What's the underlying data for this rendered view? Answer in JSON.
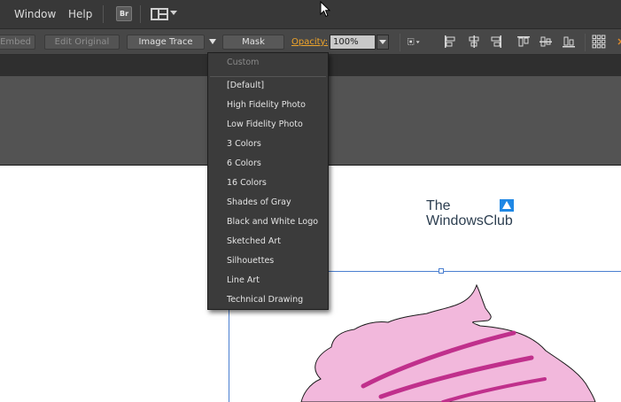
{
  "menubar": {
    "items": [
      "Window",
      "Help"
    ],
    "bridge_label": "Br"
  },
  "controlbar": {
    "embed_label": "Embed",
    "edit_original_label": "Edit Original",
    "image_trace_label": "Image Trace",
    "mask_label": "Mask",
    "opacity_label": "Opacity:",
    "opacity_value": "100%"
  },
  "dropdown": {
    "header": "Custom",
    "items": [
      "[Default]",
      "High Fidelity Photo",
      "Low Fidelity Photo",
      "3 Colors",
      "6 Colors",
      "16 Colors",
      "Shades of Gray",
      "Black and White Logo",
      "Sketched Art",
      "Silhouettes",
      "Line Art",
      "Technical Drawing"
    ]
  },
  "watermark": {
    "line1": "The",
    "line2": "WindowsClub"
  },
  "colors": {
    "accent_opacity": "#f0a52a",
    "selection": "#4a7fd0",
    "cupcake_frosting": "#f2b8dc",
    "cupcake_stripe": "#c0308c"
  }
}
